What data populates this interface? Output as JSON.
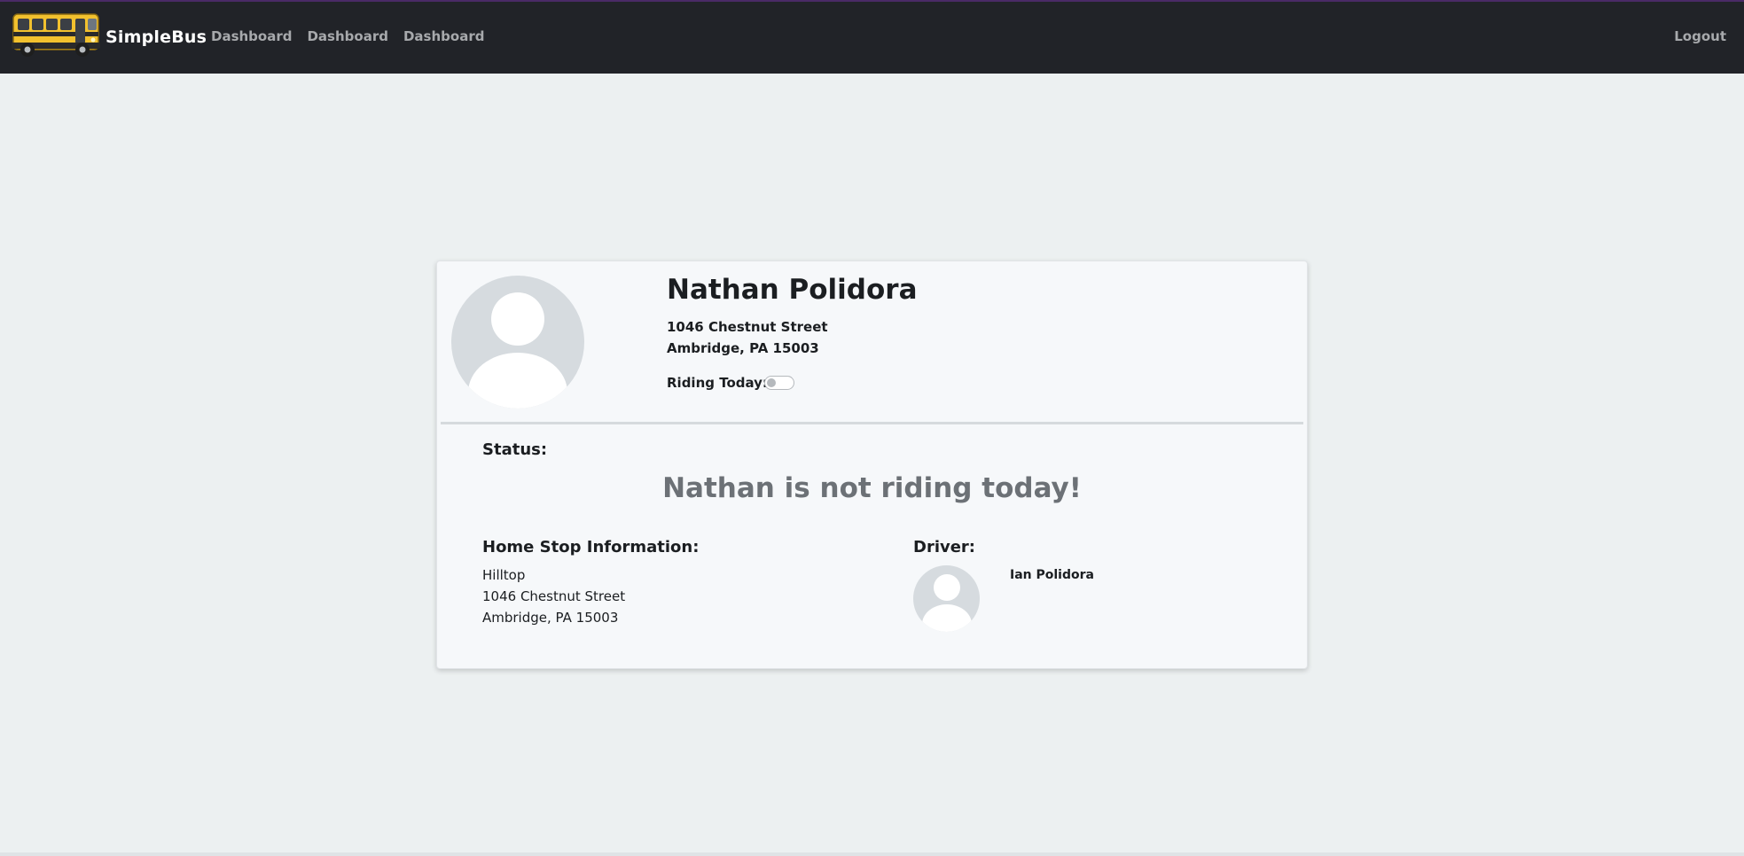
{
  "brand": {
    "name": "SimpleBus",
    "logo_icon": "school-bus-icon",
    "colors": {
      "bus_body": "#f2c12e",
      "bus_stripe": "#2a2a2a"
    }
  },
  "nav": {
    "links": [
      "Dashboard",
      "Dashboard",
      "Dashboard"
    ],
    "logout_label": "Logout"
  },
  "student": {
    "name": "Nathan Polidora",
    "address_line1": "1046 Chestnut Street",
    "address_line2": "Ambridge, PA 15003",
    "riding_today_label": "Riding Today:",
    "riding_today": false,
    "avatar_icon": "user-avatar-icon"
  },
  "status": {
    "label": "Status:",
    "message": "Nathan is not riding today!"
  },
  "home_stop": {
    "label": "Home Stop Information:",
    "stop_name": "Hilltop",
    "address_line1": "1046 Chestnut Street",
    "address_line2": "Ambridge, PA 15003"
  },
  "driver": {
    "label": "Driver:",
    "name": "Ian Polidora",
    "avatar_icon": "user-avatar-icon"
  },
  "colors": {
    "navbar": "#212328",
    "page_background": "#ecf0f1",
    "card_background": "#f6f8fa",
    "muted_text": "#6c7176"
  }
}
